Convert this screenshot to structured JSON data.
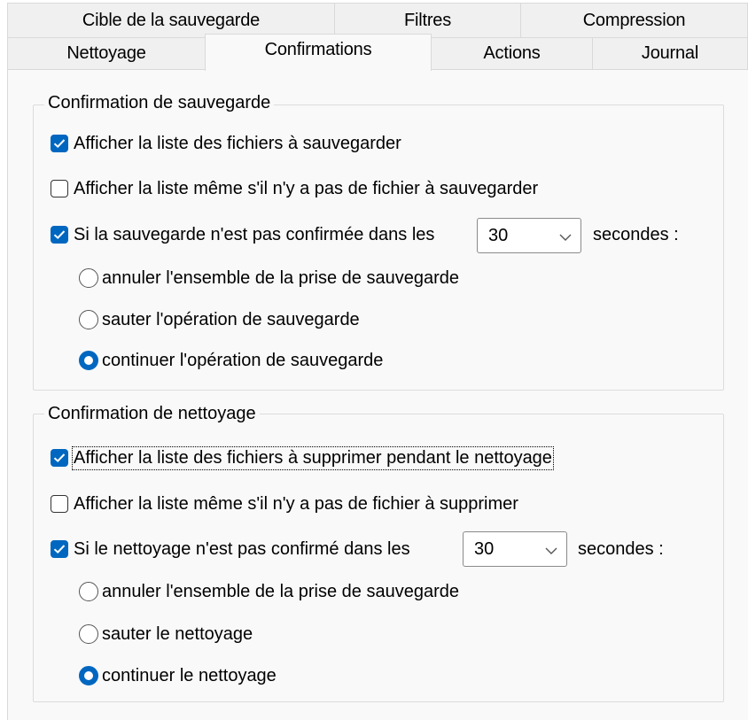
{
  "tabs_row1": [
    "Cible de la sauvegarde",
    "Filtres",
    "Compression"
  ],
  "tabs_row2": [
    "Nettoyage",
    "Confirmations",
    "Actions",
    "Journal"
  ],
  "active_tab": "Confirmations",
  "backup_group": {
    "title": "Confirmation de sauvegarde",
    "show_list": {
      "label": "Afficher la liste des fichiers à sauvegarder",
      "checked": true
    },
    "show_if_empty": {
      "label": "Afficher la liste même s'il n'y a pas de fichier à sauvegarder",
      "checked": false
    },
    "timeout": {
      "label": "Si la sauvegarde n'est pas confirmée dans les",
      "checked": true,
      "value": "30",
      "suffix": "secondes :"
    },
    "options": [
      {
        "label": "annuler l'ensemble de la prise de sauvegarde",
        "selected": false
      },
      {
        "label": "sauter l'opération de sauvegarde",
        "selected": false
      },
      {
        "label": "continuer l'opération de sauvegarde",
        "selected": true
      }
    ]
  },
  "cleanup_group": {
    "title": "Confirmation de nettoyage",
    "show_list": {
      "label": "Afficher la liste des fichiers à supprimer pendant le nettoyage",
      "checked": true
    },
    "show_if_empty": {
      "label": "Afficher la liste même s'il n'y a pas de fichier à supprimer",
      "checked": false
    },
    "timeout": {
      "label": "Si le nettoyage n'est pas confirmé dans les",
      "checked": true,
      "value": "30",
      "suffix": "secondes :"
    },
    "options": [
      {
        "label": "annuler l'ensemble de la prise de sauvegarde",
        "selected": false
      },
      {
        "label": "sauter le nettoyage",
        "selected": false
      },
      {
        "label": "continuer le nettoyage",
        "selected": true
      }
    ]
  },
  "colors": {
    "accent": "#0067c0",
    "panel": "#f9f9f9",
    "tab": "#f0f0f0",
    "border": "#d9d9d9"
  }
}
